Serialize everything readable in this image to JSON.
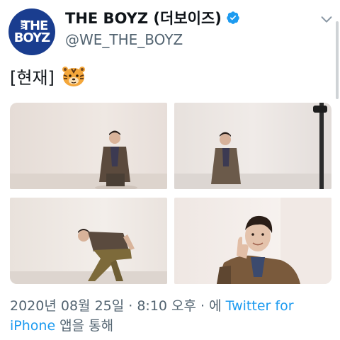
{
  "account": {
    "avatar_text_small": "WE",
    "avatar_text_line1": "THE",
    "avatar_text_line2": "BOYZ",
    "display_name": "THE BOYZ (더보이즈)",
    "handle": "@WE_THE_BOYZ",
    "verified_icon": "verified-badge-icon",
    "menu_icon": "chevron-down-icon"
  },
  "tweet": {
    "text": "[현재]",
    "emoji_icon": "tiger-face-icon",
    "photos": [
      {
        "name": "photo-1"
      },
      {
        "name": "photo-2"
      },
      {
        "name": "photo-3"
      },
      {
        "name": "photo-4"
      }
    ]
  },
  "footer": {
    "timestamp": "2020년 08월 25일 · 8:10 오후 · 에 ",
    "source_part1": "Twitter for",
    "source_part2": "iPhone",
    "suffix": " 앱을 통해"
  },
  "colors": {
    "accent": "#1d9bf0",
    "text": "#0f1419",
    "secondary": "#536471",
    "avatar_bg": "#1a3d8f"
  }
}
